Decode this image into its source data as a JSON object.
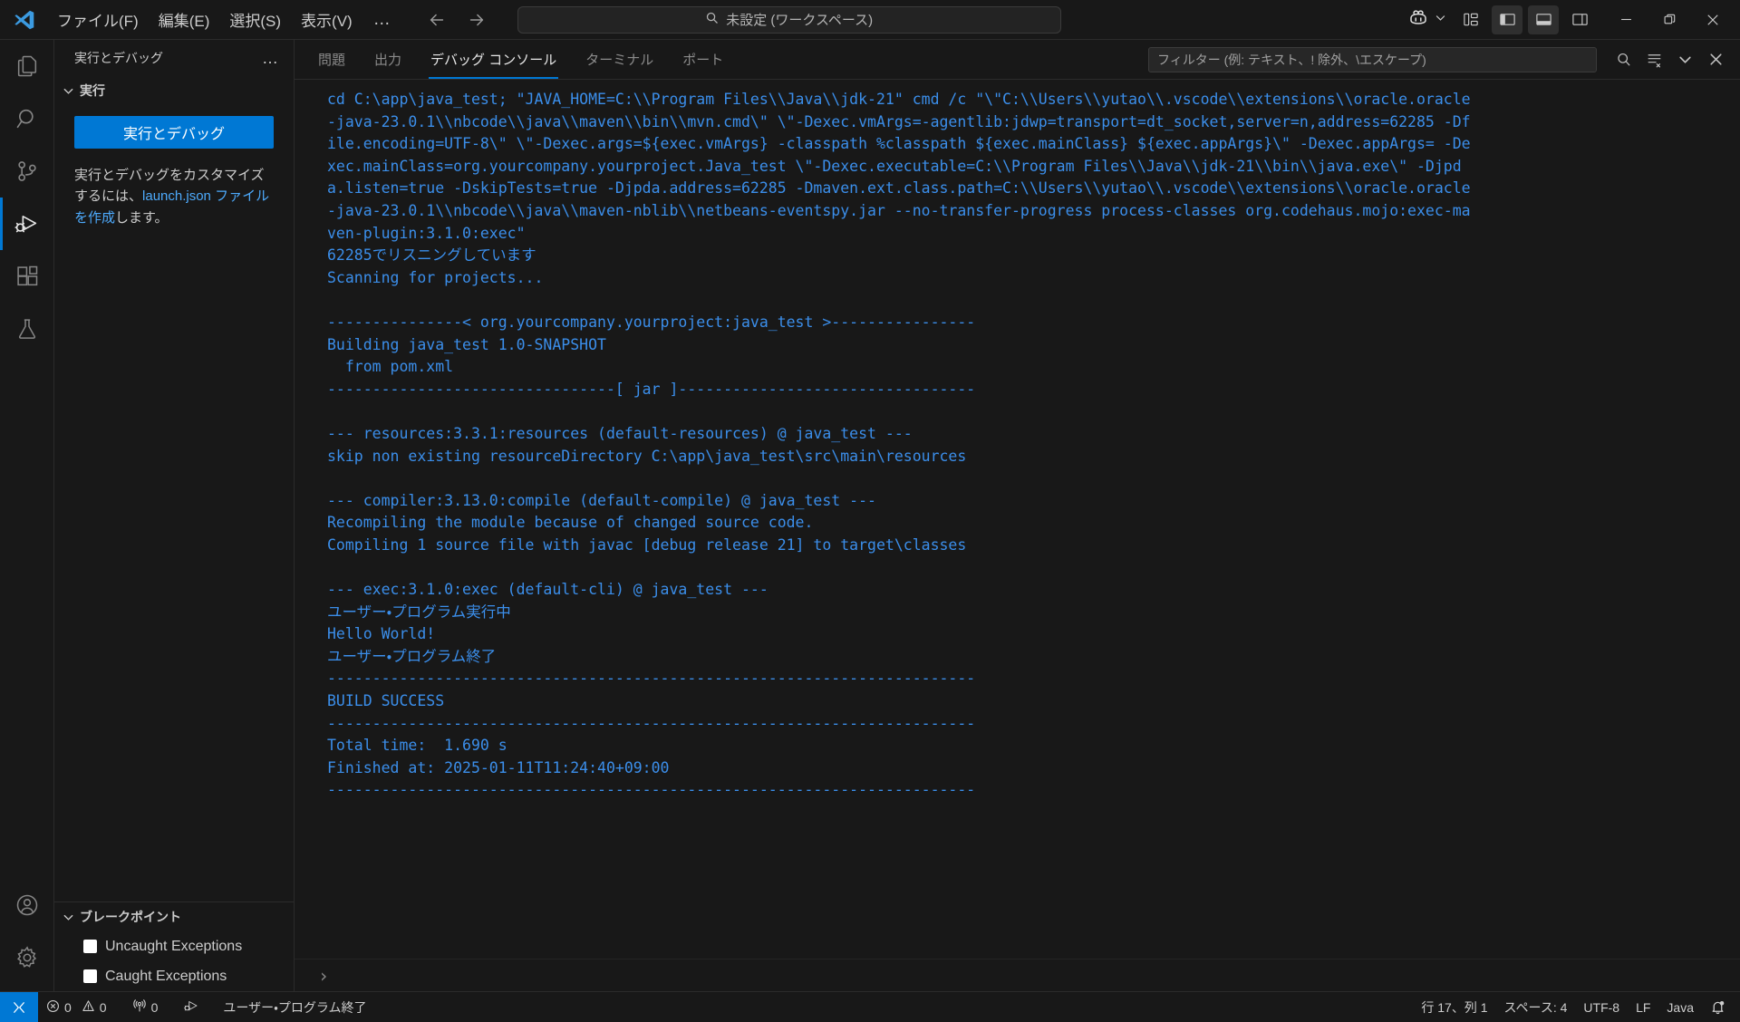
{
  "titlebar": {
    "logo_icon": "vscode-logo-icon",
    "menu": [
      {
        "label": "ファイル(F)",
        "name": "menu-file"
      },
      {
        "label": "編集(E)",
        "name": "menu-edit"
      },
      {
        "label": "選択(S)",
        "name": "menu-selection"
      },
      {
        "label": "表示(V)",
        "name": "menu-view"
      }
    ],
    "more_label": "…",
    "back_icon": "arrow-left-icon",
    "forward_icon": "arrow-right-icon",
    "command_center": {
      "icon": "search-icon",
      "value": "未設定 (ワークスペース)"
    },
    "copilot_icon": "copilot-icon",
    "copilot_chevron_icon": "chevron-down-icon",
    "layout_icons": [
      {
        "name": "customize-layout-icon",
        "active": false
      },
      {
        "name": "toggle-primary-sidebar-icon",
        "active": true
      },
      {
        "name": "toggle-panel-icon",
        "active": true
      },
      {
        "name": "toggle-secondary-sidebar-icon",
        "active": false
      }
    ],
    "window_controls": [
      {
        "name": "minimize-button",
        "glyph": "minimize"
      },
      {
        "name": "restore-button",
        "glyph": "restore"
      },
      {
        "name": "close-button",
        "glyph": "close"
      }
    ]
  },
  "activitybar": {
    "items": [
      {
        "name": "activity-explorer",
        "icon": "files-icon",
        "active": false
      },
      {
        "name": "activity-search",
        "icon": "search-icon",
        "active": false
      },
      {
        "name": "activity-source-control",
        "icon": "source-control-icon",
        "active": false
      },
      {
        "name": "activity-run-debug",
        "icon": "run-debug-icon",
        "active": true
      },
      {
        "name": "activity-extensions",
        "icon": "extensions-icon",
        "active": false
      },
      {
        "name": "activity-testing",
        "icon": "beaker-icon",
        "active": false
      }
    ],
    "bottom": [
      {
        "name": "activity-accounts",
        "icon": "account-icon"
      },
      {
        "name": "activity-manage",
        "icon": "gear-icon"
      }
    ]
  },
  "sidebar": {
    "title": "実行とデバッグ",
    "more_actions_label": "…",
    "section": {
      "chevron_icon": "chevron-down-icon",
      "label": "実行"
    },
    "run_button_label": "実行とデバッグ",
    "description_prefix": "実行とデバッグをカスタマイズするには、",
    "description_link": "launch.json ファイルを作成",
    "description_suffix": "します。",
    "breakpoints": {
      "chevron_icon": "chevron-down-icon",
      "label": "ブレークポイント",
      "items": [
        {
          "label": "Uncaught Exceptions",
          "checked": false
        },
        {
          "label": "Caught Exceptions",
          "checked": false
        }
      ]
    }
  },
  "panel": {
    "tabs": [
      {
        "label": "問題",
        "name": "tab-problems",
        "active": false
      },
      {
        "label": "出力",
        "name": "tab-output",
        "active": false
      },
      {
        "label": "デバッグ コンソール",
        "name": "tab-debug-console",
        "active": true
      },
      {
        "label": "ターミナル",
        "name": "tab-terminal",
        "active": false
      },
      {
        "label": "ポート",
        "name": "tab-ports",
        "active": false
      }
    ],
    "filter": {
      "placeholder": "フィルター (例: テキスト、! 除外、\\エスケープ)",
      "value": ""
    },
    "tools": [
      {
        "name": "filter-search-icon",
        "icon": "search"
      },
      {
        "name": "clear-console-icon",
        "icon": "clear-all"
      },
      {
        "name": "panel-chevron-down-icon",
        "icon": "chevron-down"
      },
      {
        "name": "panel-close-icon",
        "icon": "close"
      }
    ],
    "console_lines": [
      "cd C:\\app\\java_test; \"JAVA_HOME=C:\\\\Program Files\\\\Java\\\\jdk-21\" cmd /c \"\\\"C:\\\\Users\\\\yutao\\\\.vscode\\\\extensions\\\\oracle.oracle",
      "-java-23.0.1\\\\nbcode\\\\java\\\\maven\\\\bin\\\\mvn.cmd\\\" \\\"-Dexec.vmArgs=-agentlib:jdwp=transport=dt_socket,server=n,address=62285 -Df",
      "ile.encoding=UTF-8\\\" \\\"-Dexec.args=${exec.vmArgs} -classpath %classpath ${exec.mainClass} ${exec.appArgs}\\\" -Dexec.appArgs= -De",
      "xec.mainClass=org.yourcompany.yourproject.Java_test \\\"-Dexec.executable=C:\\\\Program Files\\\\Java\\\\jdk-21\\\\bin\\\\java.exe\\\" -Djpd",
      "a.listen=true -DskipTests=true -Djpda.address=62285 -Dmaven.ext.class.path=C:\\\\Users\\\\yutao\\\\.vscode\\\\extensions\\\\oracle.oracle",
      "-java-23.0.1\\\\nbcode\\\\java\\\\maven-nblib\\\\netbeans-eventspy.jar --no-transfer-progress process-classes org.codehaus.mojo:exec-ma",
      "ven-plugin:3.1.0:exec\"",
      "62285でリスニングしています",
      "Scanning for projects...",
      "",
      "---------------< org.yourcompany.yourproject:java_test >----------------",
      "Building java_test 1.0-SNAPSHOT",
      "  from pom.xml",
      "--------------------------------[ jar ]---------------------------------",
      "",
      "--- resources:3.3.1:resources (default-resources) @ java_test ---",
      "skip non existing resourceDirectory C:\\app\\java_test\\src\\main\\resources",
      "",
      "--- compiler:3.13.0:compile (default-compile) @ java_test ---",
      "Recompiling the module because of changed source code.",
      "Compiling 1 source file with javac [debug release 21] to target\\classes",
      "",
      "--- exec:3.1.0:exec (default-cli) @ java_test ---",
      "ユーザー・プログラム実行中",
      "Hello World!",
      "ユーザー・プログラム終了",
      "------------------------------------------------------------------------",
      "BUILD SUCCESS",
      "------------------------------------------------------------------------",
      "Total time:  1.690 s",
      "Finished at: 2025-01-11T11:24:40+09:00",
      "------------------------------------------------------------------------"
    ],
    "input_prompt": "›"
  },
  "statusbar": {
    "remote_icon": "remote-window-icon",
    "left": [
      {
        "name": "status-errors",
        "icon": "error-icon",
        "label": "0"
      },
      {
        "name": "status-warnings",
        "icon": "warning-icon",
        "label": "0"
      },
      {
        "name": "status-ports",
        "icon": "radio-tower-icon",
        "label": "0"
      },
      {
        "name": "status-debug",
        "icon": "run-debug-icon",
        "label": ""
      },
      {
        "name": "status-message",
        "icon": "",
        "label": "ユーザー・プログラム終了"
      }
    ],
    "right": [
      {
        "name": "status-line-col",
        "label": "行 17、列 1"
      },
      {
        "name": "status-indentation",
        "label": "スペース: 4"
      },
      {
        "name": "status-encoding",
        "label": "UTF-8"
      },
      {
        "name": "status-eol",
        "label": "LF"
      },
      {
        "name": "status-language",
        "label": "Java"
      }
    ],
    "bell_icon": "bell-dot-icon"
  },
  "colors": {
    "accent": "#0078d4",
    "console_text": "#3b8eea",
    "background": "#181818",
    "link": "#4daafc"
  }
}
